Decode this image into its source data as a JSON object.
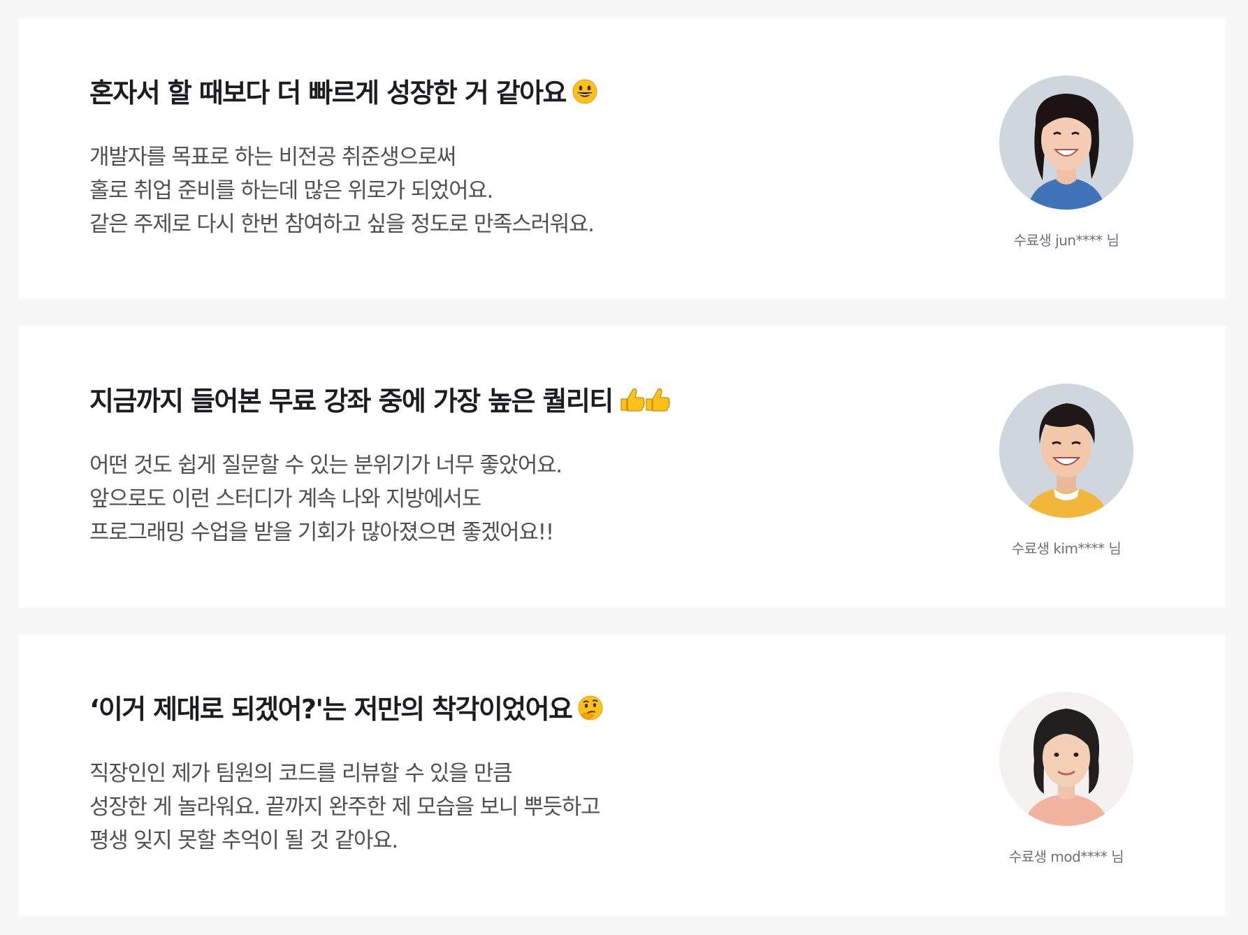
{
  "reviews": [
    {
      "title": "혼자서 할 때보다 더 빠르게 성장한 거 같아요",
      "emoji": "grinning-face-emoji",
      "lines": [
        "개발자를 목표로 하는 비전공 취준생으로써",
        "홀로 취업 준비를 하는데 많은 위로가 되었어요.",
        "같은 주제로 다시 한번 참여하고 싶을 정도로 만족스러워요."
      ],
      "student": "수료생 jun**** 님"
    },
    {
      "title": "지금까지 들어본 무료 강좌 중에 가장 높은 퀄리티",
      "emoji": "two-thumbs-up-emoji",
      "lines": [
        "어떤 것도 쉽게 질문할 수 있는 분위기가 너무 좋았어요.",
        "앞으로도 이런 스터디가 계속 나와 지방에서도",
        "프로그래밍 수업을 받을 기회가 많아졌으면 좋겠어요!!"
      ],
      "student": "수료생 kim**** 님"
    },
    {
      "title": "‘이거 제대로 되겠어?'는 저만의 착각이었어요",
      "emoji": "thinking-face-emoji",
      "lines": [
        "직장인인 제가 팀원의 코드를 리뷰할 수 있을 만큼",
        "성장한 게 놀라워요. 끝까지 완주한 제 모습을 보니 뿌듯하고",
        "평생 잊지 못할 추억이 될 것 같아요."
      ],
      "student": "수료생 mod**** 님"
    }
  ],
  "colors": {
    "page_background": "#f7f7f7",
    "card_background": "#ffffff",
    "title": "#1d1d1f",
    "body": "#505050",
    "student_name": "#6e6e73"
  }
}
